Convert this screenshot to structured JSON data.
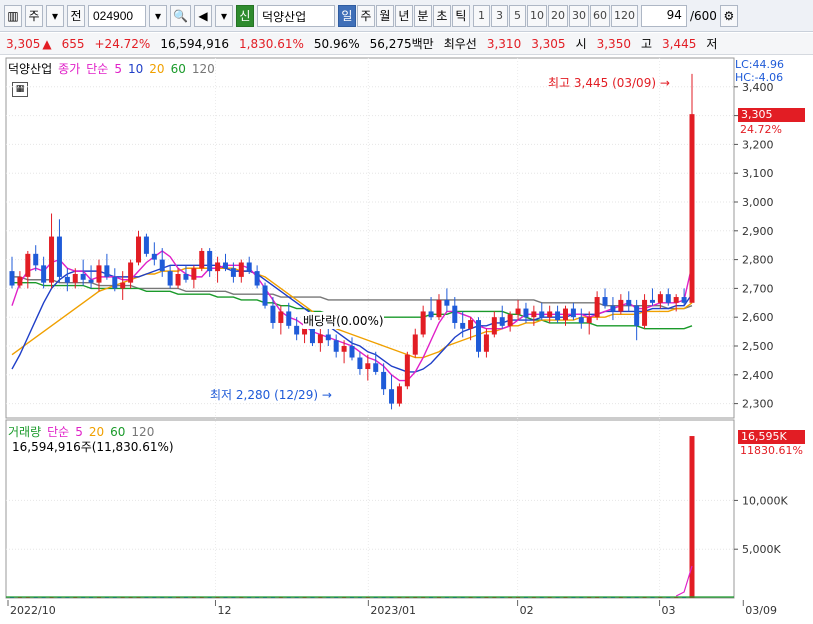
{
  "toolbar": {
    "market_label": "주",
    "type_label": "전",
    "stock_code": "024900",
    "search_icon": "search-icon",
    "speaker_icon": "speaker-icon",
    "new_badge": "신",
    "stock_name": "덕양산업",
    "periods": [
      "일",
      "주",
      "월",
      "년",
      "분",
      "초",
      "틱"
    ],
    "active_period": "일",
    "intervals": [
      "1",
      "3",
      "5",
      "10",
      "20",
      "30",
      "60",
      "120"
    ],
    "count_value": "94",
    "count_total": "/600"
  },
  "info_bar": {
    "price": "3,305",
    "change": "655",
    "change_pct": "+24.72%",
    "volume": "16,594,916",
    "volume_pct": "1,830.61%",
    "turnover_pct": "50.96%",
    "amount": "56,275백만",
    "best_bid_label": "최우선",
    "best_bid": "3,310",
    "best_ask": "3,305",
    "open_label": "시",
    "open": "3,350",
    "high_label": "고",
    "high": "3,445",
    "low_label": "저"
  },
  "price_legend": {
    "name": "덕양산업",
    "close_label": "종가",
    "simple_label": "단순",
    "ma": [
      "5",
      "10",
      "20",
      "60",
      "120"
    ]
  },
  "volume_legend": {
    "name": "거래량",
    "simple_label": "단순",
    "ma": [
      "5",
      "20",
      "60",
      "120"
    ],
    "current": "16,594,916주(11,830.61%)"
  },
  "indicators": {
    "lc": "LC:44.96",
    "hc": "HC:-4.06"
  },
  "annotations": {
    "high": "최고 3,445 (03/09)",
    "low": "최저 2,280 (12/29)",
    "dividend": "배당락(0.00%)"
  },
  "price_tags": {
    "last": "3,305",
    "pct": "24.72%"
  },
  "volume_tags": {
    "last": "16,595K",
    "pct": "11830.61%"
  },
  "colors": {
    "up": "#e21d24",
    "down": "#1f5bd8",
    "ma5": "#e020c8",
    "ma10": "#1f3fc8",
    "ma20": "#f0a000",
    "ma60": "#1a9a2a",
    "ma120": "#777777"
  },
  "chart_data": [
    {
      "type": "candlestick",
      "title": "덕양산업",
      "ylim": [
        2250,
        3500
      ],
      "y_ticks": [
        2300,
        2400,
        2500,
        2600,
        2700,
        2800,
        2900,
        3000,
        3100,
        3200,
        3300,
        3400
      ],
      "x_labels": [
        "2022/10",
        "12",
        "2023/01",
        "02",
        "03",
        "03/09"
      ],
      "candles": [
        [
          2760,
          2810,
          2700,
          2710
        ],
        [
          2710,
          2760,
          2700,
          2740
        ],
        [
          2740,
          2830,
          2700,
          2820
        ],
        [
          2820,
          2850,
          2760,
          2780
        ],
        [
          2780,
          2810,
          2700,
          2720
        ],
        [
          2720,
          2960,
          2700,
          2880
        ],
        [
          2880,
          2940,
          2720,
          2740
        ],
        [
          2740,
          2770,
          2690,
          2720
        ],
        [
          2720,
          2770,
          2700,
          2750
        ],
        [
          2750,
          2800,
          2710,
          2730
        ],
        [
          2730,
          2780,
          2700,
          2720
        ],
        [
          2720,
          2800,
          2690,
          2780
        ],
        [
          2780,
          2820,
          2730,
          2740
        ],
        [
          2740,
          2770,
          2690,
          2700
        ],
        [
          2700,
          2760,
          2660,
          2720
        ],
        [
          2720,
          2800,
          2700,
          2790
        ],
        [
          2790,
          2900,
          2780,
          2880
        ],
        [
          2880,
          2890,
          2810,
          2820
        ],
        [
          2820,
          2860,
          2780,
          2800
        ],
        [
          2800,
          2840,
          2740,
          2760
        ],
        [
          2760,
          2780,
          2700,
          2710
        ],
        [
          2710,
          2770,
          2700,
          2750
        ],
        [
          2750,
          2780,
          2720,
          2730
        ],
        [
          2730,
          2780,
          2700,
          2770
        ],
        [
          2770,
          2840,
          2760,
          2830
        ],
        [
          2830,
          2840,
          2740,
          2760
        ],
        [
          2760,
          2810,
          2720,
          2790
        ],
        [
          2790,
          2820,
          2760,
          2770
        ],
        [
          2770,
          2790,
          2720,
          2740
        ],
        [
          2740,
          2800,
          2720,
          2790
        ],
        [
          2790,
          2810,
          2750,
          2760
        ],
        [
          2760,
          2780,
          2700,
          2710
        ],
        [
          2710,
          2720,
          2630,
          2640
        ],
        [
          2640,
          2670,
          2560,
          2580
        ],
        [
          2580,
          2640,
          2540,
          2620
        ],
        [
          2620,
          2650,
          2560,
          2570
        ],
        [
          2570,
          2600,
          2520,
          2540
        ],
        [
          2540,
          2580,
          2510,
          2560
        ],
        [
          2560,
          2590,
          2500,
          2510
        ],
        [
          2510,
          2560,
          2480,
          2540
        ],
        [
          2540,
          2570,
          2500,
          2520
        ],
        [
          2520,
          2540,
          2460,
          2480
        ],
        [
          2480,
          2520,
          2440,
          2500
        ],
        [
          2500,
          2530,
          2450,
          2460
        ],
        [
          2460,
          2480,
          2400,
          2420
        ],
        [
          2420,
          2470,
          2380,
          2440
        ],
        [
          2440,
          2480,
          2400,
          2410
        ],
        [
          2410,
          2440,
          2330,
          2350
        ],
        [
          2350,
          2400,
          2280,
          2300
        ],
        [
          2300,
          2370,
          2290,
          2360
        ],
        [
          2360,
          2480,
          2350,
          2470
        ],
        [
          2470,
          2560,
          2460,
          2540
        ],
        [
          2540,
          2640,
          2530,
          2620
        ],
        [
          2620,
          2670,
          2590,
          2600
        ],
        [
          2600,
          2680,
          2590,
          2660
        ],
        [
          2660,
          2700,
          2620,
          2640
        ],
        [
          2640,
          2670,
          2560,
          2580
        ],
        [
          2580,
          2620,
          2530,
          2560
        ],
        [
          2560,
          2600,
          2520,
          2590
        ],
        [
          2590,
          2600,
          2460,
          2480
        ],
        [
          2480,
          2560,
          2460,
          2540
        ],
        [
          2540,
          2620,
          2530,
          2600
        ],
        [
          2600,
          2640,
          2560,
          2570
        ],
        [
          2570,
          2620,
          2550,
          2610
        ],
        [
          2610,
          2660,
          2590,
          2630
        ],
        [
          2630,
          2650,
          2580,
          2600
        ],
        [
          2600,
          2640,
          2570,
          2620
        ],
        [
          2620,
          2650,
          2590,
          2600
        ],
        [
          2600,
          2640,
          2580,
          2620
        ],
        [
          2620,
          2640,
          2580,
          2590
        ],
        [
          2590,
          2640,
          2570,
          2630
        ],
        [
          2630,
          2650,
          2590,
          2600
        ],
        [
          2600,
          2630,
          2560,
          2580
        ],
        [
          2580,
          2620,
          2540,
          2600
        ],
        [
          2600,
          2690,
          2590,
          2670
        ],
        [
          2670,
          2700,
          2630,
          2640
        ],
        [
          2640,
          2670,
          2590,
          2620
        ],
        [
          2620,
          2680,
          2610,
          2660
        ],
        [
          2660,
          2690,
          2620,
          2640
        ],
        [
          2640,
          2660,
          2520,
          2570
        ],
        [
          2570,
          2680,
          2560,
          2660
        ],
        [
          2660,
          2700,
          2640,
          2650
        ],
        [
          2650,
          2690,
          2630,
          2680
        ],
        [
          2680,
          2700,
          2640,
          2650
        ],
        [
          2650,
          2680,
          2620,
          2670
        ],
        [
          2670,
          2700,
          2640,
          2650
        ],
        [
          2650,
          3445,
          3150,
          3305
        ]
      ],
      "ma5": [
        2640,
        2720,
        2760,
        2770,
        2760,
        2790,
        2800,
        2770,
        2760,
        2760,
        2730,
        2740,
        2740,
        2740,
        2730,
        2730,
        2760,
        2790,
        2810,
        2830,
        2810,
        2770,
        2750,
        2740,
        2740,
        2770,
        2770,
        2780,
        2780,
        2780,
        2770,
        2740,
        2700,
        2660,
        2620,
        2600,
        2590,
        2570,
        2550,
        2540,
        2530,
        2520,
        2510,
        2500,
        2480,
        2460,
        2450,
        2430,
        2400,
        2380,
        2380,
        2410,
        2460,
        2520,
        2580,
        2620,
        2620,
        2610,
        2600,
        2570,
        2560,
        2560,
        2560,
        2570,
        2590,
        2610,
        2610,
        2610,
        2610,
        2610,
        2610,
        2610,
        2610,
        2600,
        2610,
        2620,
        2630,
        2640,
        2650,
        2630,
        2630,
        2640,
        2650,
        2650,
        2650,
        2660,
        2780
      ],
      "ma10": [
        2420,
        2470,
        2530,
        2590,
        2650,
        2700,
        2730,
        2750,
        2760,
        2760,
        2760,
        2760,
        2750,
        2740,
        2740,
        2740,
        2740,
        2750,
        2760,
        2770,
        2780,
        2780,
        2780,
        2780,
        2780,
        2780,
        2780,
        2770,
        2760,
        2760,
        2760,
        2750,
        2730,
        2710,
        2690,
        2670,
        2650,
        2630,
        2610,
        2590,
        2570,
        2550,
        2530,
        2510,
        2500,
        2480,
        2470,
        2450,
        2430,
        2420,
        2410,
        2410,
        2420,
        2440,
        2470,
        2500,
        2530,
        2550,
        2560,
        2570,
        2570,
        2580,
        2580,
        2590,
        2590,
        2590,
        2590,
        2600,
        2600,
        2600,
        2600,
        2610,
        2610,
        2610,
        2610,
        2620,
        2620,
        2620,
        2620,
        2620,
        2620,
        2630,
        2630,
        2630,
        2640,
        2640,
        2680
      ],
      "ma20": [
        2470,
        2490,
        2510,
        2530,
        2550,
        2570,
        2590,
        2610,
        2630,
        2650,
        2670,
        2690,
        2700,
        2710,
        2720,
        2730,
        2740,
        2750,
        2750,
        2760,
        2760,
        2760,
        2770,
        2770,
        2770,
        2770,
        2770,
        2770,
        2770,
        2760,
        2760,
        2750,
        2740,
        2720,
        2700,
        2680,
        2660,
        2640,
        2620,
        2600,
        2580,
        2560,
        2550,
        2540,
        2530,
        2520,
        2510,
        2500,
        2490,
        2480,
        2470,
        2460,
        2460,
        2470,
        2480,
        2500,
        2510,
        2520,
        2530,
        2540,
        2550,
        2550,
        2560,
        2570,
        2570,
        2580,
        2580,
        2590,
        2590,
        2590,
        2590,
        2590,
        2600,
        2600,
        2600,
        2600,
        2610,
        2610,
        2610,
        2610,
        2620,
        2620,
        2620,
        2620,
        2630,
        2630,
        2650
      ],
      "ma60": [
        2720,
        2720,
        2720,
        2720,
        2710,
        2710,
        2710,
        2710,
        2710,
        2710,
        2700,
        2700,
        2700,
        2700,
        2700,
        2700,
        2700,
        2690,
        2690,
        2690,
        2690,
        2680,
        2680,
        2680,
        2680,
        2680,
        2670,
        2670,
        2670,
        2660,
        2660,
        2660,
        2650,
        2650,
        2640,
        2640,
        2630,
        2630,
        2620,
        2620,
        2610,
        2610,
        2600,
        2600,
        2600,
        2600,
        2600,
        2600,
        2600,
        2600,
        2600,
        2600,
        2600,
        2610,
        2610,
        2610,
        2620,
        2620,
        2620,
        2620,
        2620,
        2620,
        2620,
        2610,
        2610,
        2600,
        2590,
        2590,
        2580,
        2580,
        2580,
        2580,
        2580,
        2580,
        2570,
        2570,
        2570,
        2570,
        2570,
        2570,
        2560,
        2560,
        2560,
        2560,
        2560,
        2560,
        2570
      ],
      "ma120": [
        2740,
        2740,
        2730,
        2730,
        2730,
        2730,
        2720,
        2720,
        2720,
        2720,
        2720,
        2710,
        2710,
        2710,
        2710,
        2710,
        2700,
        2700,
        2700,
        2700,
        2700,
        2700,
        2690,
        2690,
        2690,
        2690,
        2690,
        2690,
        2680,
        2680,
        2680,
        2680,
        2680,
        2680,
        2670,
        2670,
        2670,
        2670,
        2670,
        2670,
        2660,
        2660,
        2660,
        2660,
        2660,
        2660,
        2660,
        2660,
        2660,
        2660,
        2660,
        2660,
        2660,
        2660,
        2660,
        2660,
        2660,
        2660,
        2660,
        2660,
        2660,
        2660,
        2660,
        2660,
        2660,
        2660,
        2660,
        2650,
        2650,
        2650,
        2650,
        2650,
        2650,
        2650,
        2650,
        2640,
        2640,
        2640,
        2640,
        2640,
        2640,
        2640,
        2640,
        2630,
        2630,
        2630,
        2640
      ]
    },
    {
      "type": "bar",
      "title": "거래량",
      "ylabel_ticks": [
        "5,000K",
        "10,000K"
      ],
      "ylim": [
        0,
        16600
      ],
      "last_value": 16595
    }
  ]
}
